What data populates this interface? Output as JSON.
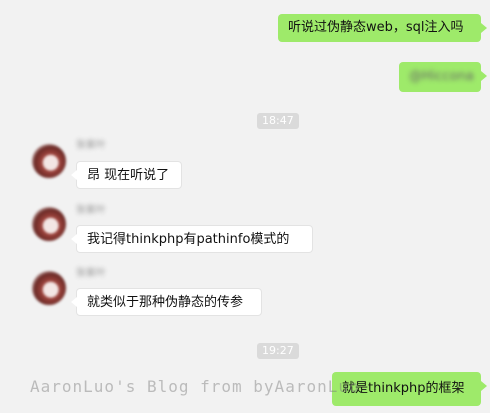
{
  "messages": {
    "m1": "听说过伪静态web，sql注入吗",
    "m2": "@Hiccona",
    "m3_sender": "张紫叶",
    "m3": "昂 现在听说了",
    "m4_sender": "张紫叶",
    "m4": "我记得thinkphp有pathinfo模式的",
    "m5_sender": "张紫叶",
    "m5": "就类似于那种伪静态的传参",
    "m6": "就是thinkphp的框架"
  },
  "times": {
    "t1": "18:47",
    "t2": "19:27"
  },
  "watermark": "AaronLuo's Blog from byAaronLuo"
}
